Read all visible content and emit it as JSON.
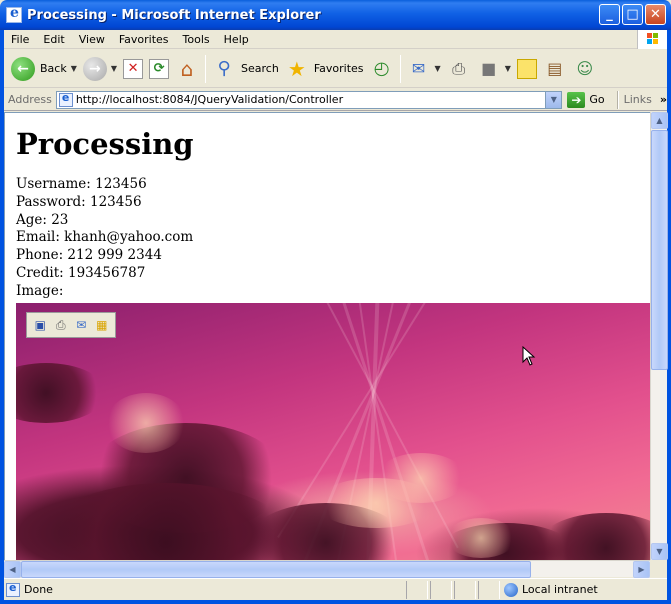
{
  "window": {
    "title": "Processing - Microsoft Internet Explorer"
  },
  "menu": [
    "File",
    "Edit",
    "View",
    "Favorites",
    "Tools",
    "Help"
  ],
  "toolbar": {
    "back_label": "Back",
    "search_label": "Search",
    "favorites_label": "Favorites"
  },
  "address": {
    "label": "Address",
    "url": "http://localhost:8084/JQueryValidation/Controller",
    "go_label": "Go",
    "links_label": "Links"
  },
  "page": {
    "heading": "Processing",
    "fields": [
      "Username: 123456",
      "Password: 123456",
      "Age: 23",
      "Email: khanh@yahoo.com",
      "Phone: 212 999 2344",
      "Credit: 193456787",
      "Image:"
    ]
  },
  "status": {
    "text": "Done",
    "zone": "Local intranet"
  }
}
